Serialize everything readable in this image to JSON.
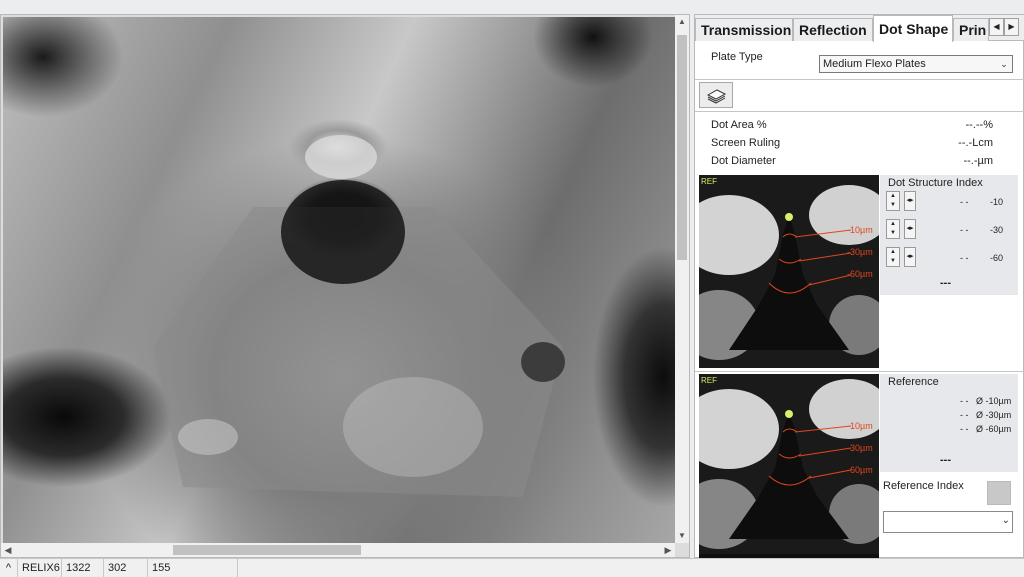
{
  "tabs": [
    "Transmission",
    "Reflection",
    "Dot Shape",
    "Prin"
  ],
  "active_tab": "Dot Shape",
  "plate": {
    "label": "Plate Type",
    "selected": "Medium Flexo Plates"
  },
  "measurements": [
    {
      "label": "Dot Area %",
      "value": "--.--%"
    },
    {
      "label": "Screen Ruling",
      "value": "--.-Lcm"
    },
    {
      "label": "Dot Diameter",
      "value": "--.-µm"
    }
  ],
  "dot_structure": {
    "title": "Dot Structure Index",
    "rows": [
      {
        "value": "- -",
        "depth": "-10"
      },
      {
        "value": "- -",
        "depth": "-30"
      },
      {
        "value": "- -",
        "depth": "-60"
      }
    ],
    "result": "---"
  },
  "reference": {
    "title": "Reference",
    "rows": [
      {
        "value": "- -",
        "depth": "Ø -10µm"
      },
      {
        "value": "- -",
        "depth": "Ø -30µm"
      },
      {
        "value": "- -",
        "depth": "Ø -60µm"
      }
    ],
    "result": "---",
    "index_label": "Reference Index",
    "index_value": ""
  },
  "thumbnail": {
    "tag": "REF",
    "depth_labels": [
      "-10µm",
      "-30µm",
      "-60µm"
    ]
  },
  "statusbar": {
    "camera": "RELIX6",
    "x": "1322",
    "y": "302",
    "value": "155"
  },
  "colors": {
    "accent_line": "#e0471e",
    "ref_tag": "#d5f06a",
    "panel_gray": "#e6e8eb"
  },
  "icons": {
    "tab_prev": "chevron-left-icon",
    "tab_next": "chevron-right-icon",
    "stack": "layers-icon",
    "dropdown": "chevron-down-icon"
  }
}
